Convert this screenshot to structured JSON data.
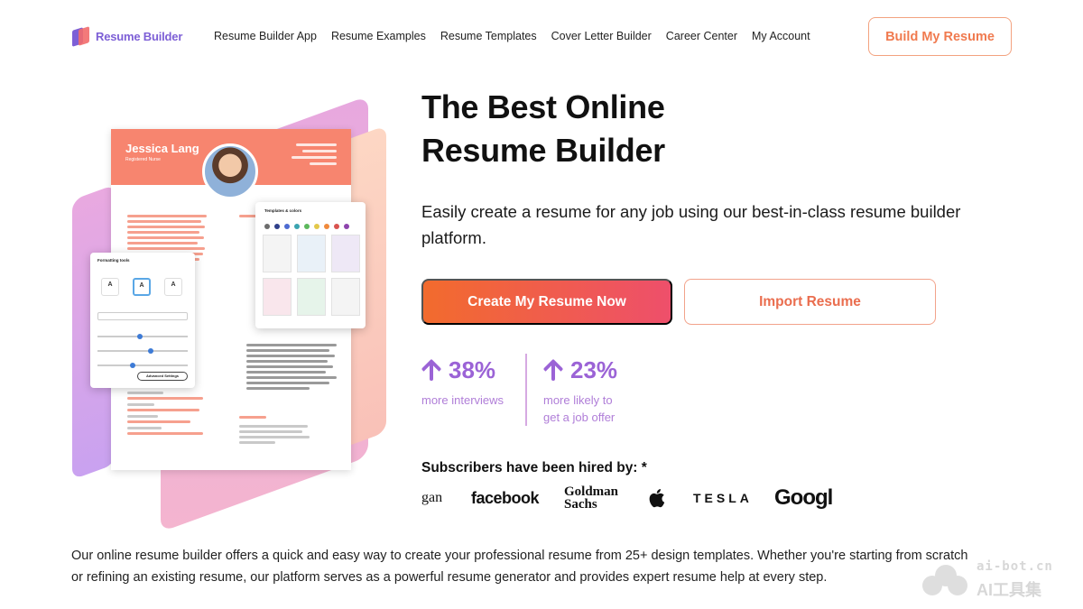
{
  "nav": {
    "logo_text": "Resume Builder",
    "links": [
      "Resume Builder App",
      "Resume Examples",
      "Resume Templates",
      "Cover Letter Builder",
      "Career Center",
      "My Account"
    ],
    "cta_label": "Build My Resume"
  },
  "hero": {
    "title_line1": "The Best Online",
    "title_line2": "Resume Builder",
    "subtitle": "Easily create a resume for any job using our best-in-class resume builder platform.",
    "primary_button": "Create My Resume Now",
    "secondary_button": "Import Resume",
    "stats": [
      {
        "value": "38%",
        "label_line1": "more interviews",
        "label_line2": ""
      },
      {
        "value": "23%",
        "label_line1": "more likely to",
        "label_line2": "get a job offer"
      }
    ],
    "hired_label": "Subscribers have been hired by: *",
    "brands": [
      "gan",
      "facebook",
      "Goldman",
      "Sachs",
      "TESLA",
      "Googl"
    ]
  },
  "resume_preview": {
    "name": "Jessica Lang",
    "role": "Registered Nurse",
    "formatting_title": "Formatting tools",
    "size_options": [
      "A",
      "A",
      "A"
    ],
    "advanced_label": "Advanced Settings",
    "templates_title": "Templates & colors",
    "swatch_colors": [
      "#6c6c6c",
      "#2f3f8a",
      "#4d6bd1",
      "#3ba4b0",
      "#5cb85c",
      "#e3c84a",
      "#f08a3c",
      "#d9534f",
      "#8e44ad"
    ]
  },
  "footer": {
    "text": "Our online resume builder offers a quick and easy way to create your professional resume from 25+ design templates. Whether you're starting from scratch or refining an existing resume, our platform serves as a powerful resume generator and provides expert resume help at every step."
  },
  "watermark": {
    "line1": "ai-bot.cn",
    "line2": "AI工具集"
  },
  "colors": {
    "brand_purple": "#7d5fd6",
    "accent_orange": "#f07a4f",
    "stat_purple": "#9b63d6"
  }
}
